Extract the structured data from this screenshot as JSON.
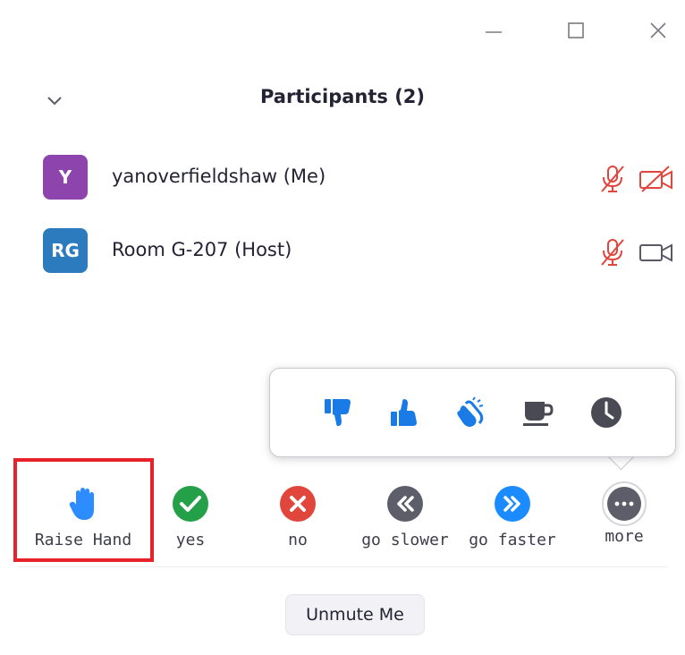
{
  "window": {
    "minimize_icon": "minimize-icon",
    "maximize_icon": "maximize-icon",
    "close_icon": "close-icon"
  },
  "panel": {
    "title": "Participants (2)",
    "collapse_icon": "chevron-down-icon"
  },
  "participants": [
    {
      "initials": "Y",
      "name": "yanoverfieldshaw (Me)",
      "avatar_color": "#8e44ad",
      "mic": "muted",
      "camera": "off"
    },
    {
      "initials": "RG",
      "name": "Room G-207 (Host)",
      "avatar_color": "#2d7bbf",
      "mic": "muted",
      "camera": "on"
    }
  ],
  "reactions": [
    {
      "icon": "thumbs-down-icon"
    },
    {
      "icon": "thumbs-up-icon"
    },
    {
      "icon": "clap-icon"
    },
    {
      "icon": "coffee-icon"
    },
    {
      "icon": "clock-icon"
    }
  ],
  "actions": [
    {
      "label": "Raise Hand",
      "icon": "raise-hand-icon",
      "highlighted": true
    },
    {
      "label": "yes",
      "icon": "check-circle-icon",
      "color": "#24a148"
    },
    {
      "label": "no",
      "icon": "x-circle-icon",
      "color": "#e0463c"
    },
    {
      "label": "go slower",
      "icon": "rewind-circle-icon",
      "color": "#5e5e6b"
    },
    {
      "label": "go faster",
      "icon": "fast-forward-circle-icon",
      "color": "#1a8cff"
    },
    {
      "label": "more",
      "icon": "more-dots-icon",
      "color": "#5e5e6b"
    }
  ],
  "unmute_button": {
    "label": "Unmute Me"
  },
  "colors": {
    "accent_blue": "#2d8cff",
    "muted_red": "#e0463c",
    "highlight_red": "#e8222b"
  }
}
